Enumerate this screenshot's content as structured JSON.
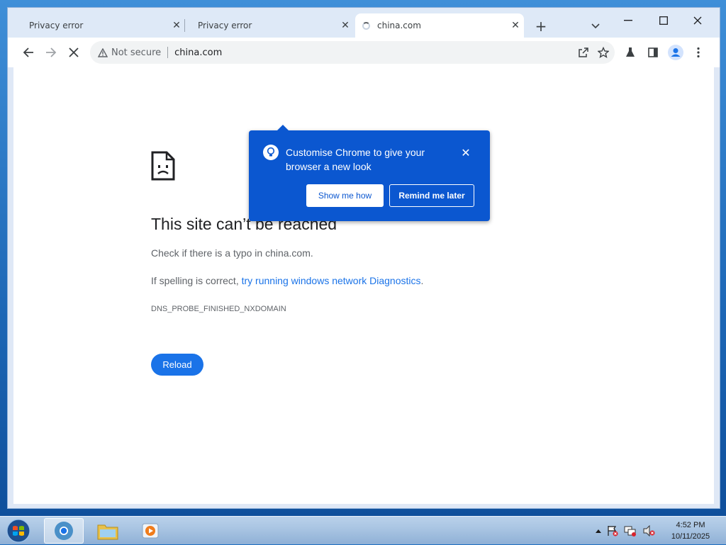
{
  "browser": {
    "tabs": [
      {
        "title": "Privacy error",
        "active": false
      },
      {
        "title": "Privacy error",
        "active": false
      },
      {
        "title": "china.com",
        "active": true,
        "loading": true
      }
    ],
    "address_bar": {
      "security_label": "Not secure",
      "url": "china.com"
    }
  },
  "promo": {
    "text": "Customise Chrome to give your browser a new look",
    "primary_button": "Show me how",
    "secondary_button": "Remind me later"
  },
  "error_page": {
    "title": "This site can’t be reached",
    "line1": "Check if there is a typo in china.com.",
    "line2_prefix": "If spelling is correct, ",
    "line2_link": "try running windows network Diagnostics",
    "line2_suffix": ".",
    "error_code": "DNS_PROBE_FINISHED_NXDOMAIN",
    "reload_label": "Reload"
  },
  "taskbar": {
    "time": "4:52 PM",
    "date": "10/11/2025"
  },
  "colors": {
    "accent": "#1a73e8",
    "promo_bg": "#0b57d0"
  }
}
